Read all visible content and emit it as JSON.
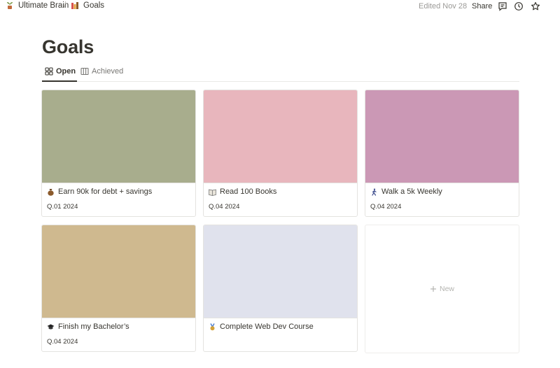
{
  "breadcrumb": {
    "workspace": "Ultimate Brain",
    "separator": "/",
    "page": "Goals"
  },
  "topbar": {
    "edited": "Edited Nov 28",
    "share": "Share",
    "icons": [
      "comment-icon",
      "history-icon",
      "star-icon"
    ]
  },
  "page": {
    "title": "Goals"
  },
  "tabs": [
    {
      "label": "Open",
      "icon": "gallery-icon",
      "active": true
    },
    {
      "label": "Achieved",
      "icon": "table-icon",
      "active": false
    }
  ],
  "cards": [
    {
      "title": "Earn 90k for debt + savings",
      "date": "Q.01 2024",
      "cover": "#a8ad8d",
      "icon": "money-bag-icon"
    },
    {
      "title": "Read 100 Books",
      "date": "Q.04 2024",
      "cover": "#e8b6bd",
      "icon": "book-icon"
    },
    {
      "title": "Walk a 5k Weekly",
      "date": "Q.04 2024",
      "cover": "#cb98b5",
      "icon": "walking-person-icon"
    },
    {
      "title": "Finish my Bachelor’s",
      "date": "Q.04 2024",
      "cover": "#cfb98f",
      "icon": "graduation-cap-icon"
    },
    {
      "title": "Complete Web Dev Course",
      "date": "",
      "cover": "#e0e2ed",
      "icon": "medal-icon"
    }
  ],
  "new_card": {
    "label": "New"
  }
}
